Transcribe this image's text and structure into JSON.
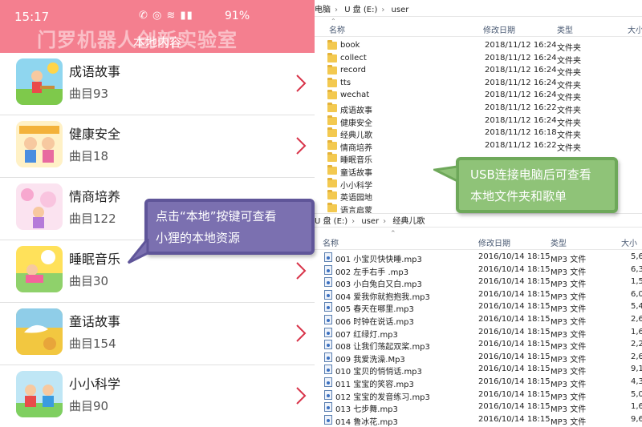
{
  "phone": {
    "status_time": "15:17",
    "status_icons": "✆ ◎ ≋ ▮▮",
    "battery": "91%",
    "watermark": "门罗机器人创新实验室",
    "title": "本地内容",
    "items": [
      {
        "title": "成语故事",
        "count": "曲目93"
      },
      {
        "title": "健康安全",
        "count": "曲目18"
      },
      {
        "title": "情商培养",
        "count": "曲目122"
      },
      {
        "title": "睡眠音乐",
        "count": "曲目30"
      },
      {
        "title": "童话故事",
        "count": "曲目154"
      },
      {
        "title": "小小科学",
        "count": "曲目90"
      }
    ]
  },
  "explorer": {
    "top_breadcrumb": [
      "电脑",
      "U 盘 (E:)",
      "user"
    ],
    "headers": {
      "name": "名称",
      "date": "修改日期",
      "type": "类型",
      "size": "大小"
    },
    "folders": [
      {
        "name": "book",
        "date": "2018/11/12 16:24",
        "type": "文件夹"
      },
      {
        "name": "collect",
        "date": "2018/11/12 16:24",
        "type": "文件夹"
      },
      {
        "name": "record",
        "date": "2018/11/12 16:24",
        "type": "文件夹"
      },
      {
        "name": "tts",
        "date": "2018/11/12 16:24",
        "type": "文件夹"
      },
      {
        "name": "wechat",
        "date": "2018/11/12 16:24",
        "type": "文件夹"
      },
      {
        "name": "成语故事",
        "date": "2018/11/12 16:22",
        "type": "文件夹"
      },
      {
        "name": "健康安全",
        "date": "2018/11/12 16:24",
        "type": "文件夹"
      },
      {
        "name": "经典儿歌",
        "date": "2018/11/12 16:18",
        "type": "文件夹"
      },
      {
        "name": "情商培养",
        "date": "2018/11/12 16:22",
        "type": "文件夹"
      },
      {
        "name": "睡眠音乐",
        "date": "",
        "type": ""
      },
      {
        "name": "童话故事",
        "date": "",
        "type": ""
      },
      {
        "name": "小小科学",
        "date": "",
        "type": ""
      },
      {
        "name": "英语园地",
        "date": "",
        "type": ""
      },
      {
        "name": "语言启蒙",
        "date": "",
        "type": ""
      }
    ],
    "second_breadcrumb": [
      "U 盘 (E:)",
      "user",
      "经典儿歌"
    ],
    "files": [
      {
        "name": "001 小宝贝快快睡.mp3",
        "date": "2016/10/14 18:15",
        "type": "MP3 文件",
        "size": "5,6"
      },
      {
        "name": "002 左手右手 .mp3",
        "date": "2016/10/14 18:15",
        "type": "MP3 文件",
        "size": "6,3"
      },
      {
        "name": "003 小白兔白又白.mp3",
        "date": "2016/10/14 18:15",
        "type": "MP3 文件",
        "size": "1,5"
      },
      {
        "name": "004 爱我你就抱抱我.mp3",
        "date": "2016/10/14 18:15",
        "type": "MP3 文件",
        "size": "6,0"
      },
      {
        "name": "005 春天在哪里.mp3",
        "date": "2016/10/14 18:15",
        "type": "MP3 文件",
        "size": "5,4"
      },
      {
        "name": "006 时钟在说话.mp3",
        "date": "2016/10/14 18:15",
        "type": "MP3 文件",
        "size": "2,6"
      },
      {
        "name": "007 红绿灯.mp3",
        "date": "2016/10/14 18:15",
        "type": "MP3 文件",
        "size": "1,6"
      },
      {
        "name": "008 让我们荡起双桨.mp3",
        "date": "2016/10/14 18:15",
        "type": "MP3 文件",
        "size": "2,2"
      },
      {
        "name": "009 我爱洗澡.Mp3",
        "date": "2016/10/14 18:15",
        "type": "MP3 文件",
        "size": "2,6"
      },
      {
        "name": "010 宝贝的悄悄话.mp3",
        "date": "2016/10/14 18:15",
        "type": "MP3 文件",
        "size": "9,1"
      },
      {
        "name": "011 宝宝的笑容.mp3",
        "date": "2016/10/14 18:15",
        "type": "MP3 文件",
        "size": "4,3"
      },
      {
        "name": "012 宝宝的发音练习.mp3",
        "date": "2016/10/14 18:15",
        "type": "MP3 文件",
        "size": "5,0"
      },
      {
        "name": "013 七步舞.mp3",
        "date": "2016/10/14 18:15",
        "type": "MP3 文件",
        "size": "1,6"
      },
      {
        "name": "014 鲁冰花.mp3",
        "date": "2016/10/14 18:15",
        "type": "MP3 文件",
        "size": "9,6"
      }
    ]
  },
  "callouts": {
    "purple": [
      "点击“本地”按键可查看",
      "小狸的本地资源"
    ],
    "green": [
      "USB连接电脑后可查看",
      "本地文件夹和歌单"
    ]
  },
  "colors": {
    "header_pink": "#f47f8f",
    "callout_purple": "#7b70b0",
    "callout_green": "#8fc378",
    "chevron_red": "#d8344a"
  }
}
